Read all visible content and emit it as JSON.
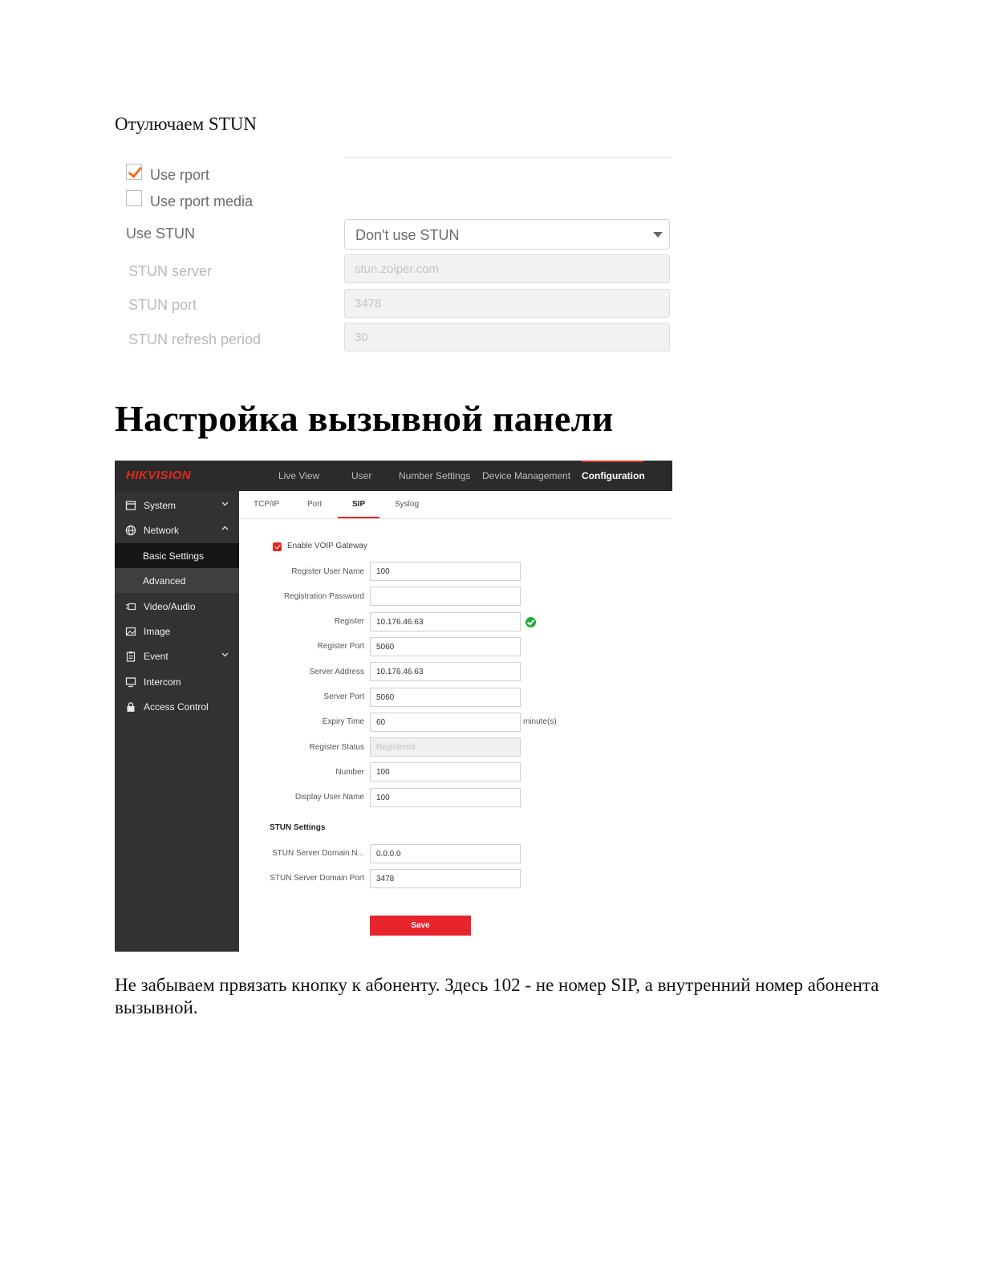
{
  "intro_text": "Отулючаем STUN",
  "zoiper": {
    "use_rport": {
      "label": "Use rport",
      "checked": true
    },
    "use_rport_media": {
      "label": "Use rport media",
      "checked": false
    },
    "use_stun": {
      "label": "Use STUN",
      "value": "Don't use STUN"
    },
    "stun_server": {
      "label": "STUN server",
      "placeholder": "stun.zoiper.com"
    },
    "stun_port": {
      "label": "STUN port",
      "placeholder": "3478"
    },
    "stun_refresh": {
      "label": "STUN refresh period",
      "placeholder": "30"
    },
    "accent_color": "#f0701d"
  },
  "heading": "Настройка вызывной панели",
  "hikvision": {
    "logo": "HIKVISION",
    "nav": [
      "Live View",
      "User",
      "Number Settings",
      "Device Management",
      "Configuration"
    ],
    "active_nav": "Configuration",
    "sidebar": {
      "system": "System",
      "network": "Network",
      "basic_settings": "Basic Settings",
      "advanced": "Advanced",
      "video_audio": "Video/Audio",
      "image": "Image",
      "event": "Event",
      "intercom": "Intercom",
      "access_control": "Access Control"
    },
    "tabs": [
      "TCP/IP",
      "Port",
      "SIP",
      "Syslog"
    ],
    "active_tab": "SIP",
    "enable_voip": {
      "label": "Enable VOIP Gateway",
      "checked": true
    },
    "fields": {
      "register_user_name": {
        "label": "Register User Name",
        "value": "100"
      },
      "registration_password": {
        "label": "Registration Password",
        "value": ""
      },
      "register": {
        "label": "Register",
        "value": "10.176.46.63"
      },
      "register_port": {
        "label": "Register Port",
        "value": "5060"
      },
      "server_address": {
        "label": "Server Address",
        "value": "10.176.46.63"
      },
      "server_port": {
        "label": "Server Port",
        "value": "5060"
      },
      "expiry_time": {
        "label": "Expiry Time",
        "value": "60",
        "unit": "minute(s)"
      },
      "register_status": {
        "label": "Register Status",
        "value": "Registered"
      },
      "number": {
        "label": "Number",
        "value": "100"
      },
      "display_user_name": {
        "label": "Display User Name",
        "value": "100"
      }
    },
    "stun_settings": {
      "title": "STUN Settings",
      "domain_name": {
        "label": "STUN Server Domain N...",
        "value": "0.0.0.0"
      },
      "domain_port": {
        "label": "STUN Server Domain Port",
        "value": "3478"
      }
    },
    "save_label": "Save",
    "brand_color": "#e0281f"
  },
  "footer_text": "Не забываем првязать кнопку к абоненту. Здесь 102 - не номер SIP, а внутренний номер абонента вызывной."
}
